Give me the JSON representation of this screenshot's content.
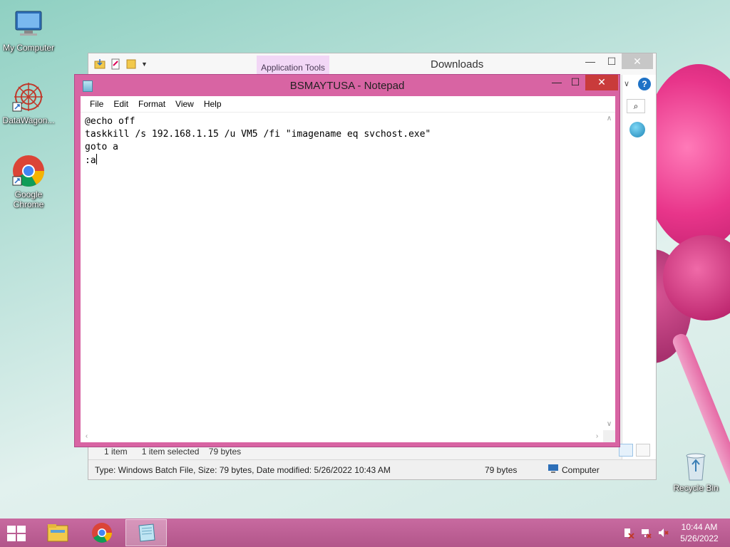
{
  "desktop": {
    "icons": [
      {
        "label": "My Computer"
      },
      {
        "label": "DataWagon..."
      },
      {
        "label": "Google Chrome"
      },
      {
        "label": "Recycle Bin"
      }
    ]
  },
  "explorer": {
    "title": "Downloads",
    "ribbon_context_tab": "Application Tools",
    "controls": {
      "minimize": "—",
      "maximize": "☐",
      "close": "✕"
    },
    "status": {
      "items": "1 item",
      "selected": "1 item selected",
      "size": "79 bytes"
    },
    "details": {
      "info": "Type: Windows Batch File, Size: 79 bytes, Date modified: 5/26/2022 10:43 AM",
      "size": "79 bytes",
      "location": "Computer"
    }
  },
  "notepad": {
    "title": "BSMAYTUSA - Notepad",
    "controls": {
      "minimize": "—",
      "maximize": "☐",
      "close": "✕"
    },
    "menu": [
      "File",
      "Edit",
      "Format",
      "View",
      "Help"
    ],
    "lines": [
      "@echo off",
      "taskkill /s 192.168.1.15 /u VM5 /fi \"imagename eq svchost.exe\"",
      "goto a",
      ":a"
    ]
  },
  "taskbar": {
    "clock_time": "10:44 AM",
    "clock_date": "5/26/2022"
  },
  "colors": {
    "notepad_frame": "#d864a3",
    "close_button": "#c93b3b",
    "taskbar": "#c86aa0"
  }
}
